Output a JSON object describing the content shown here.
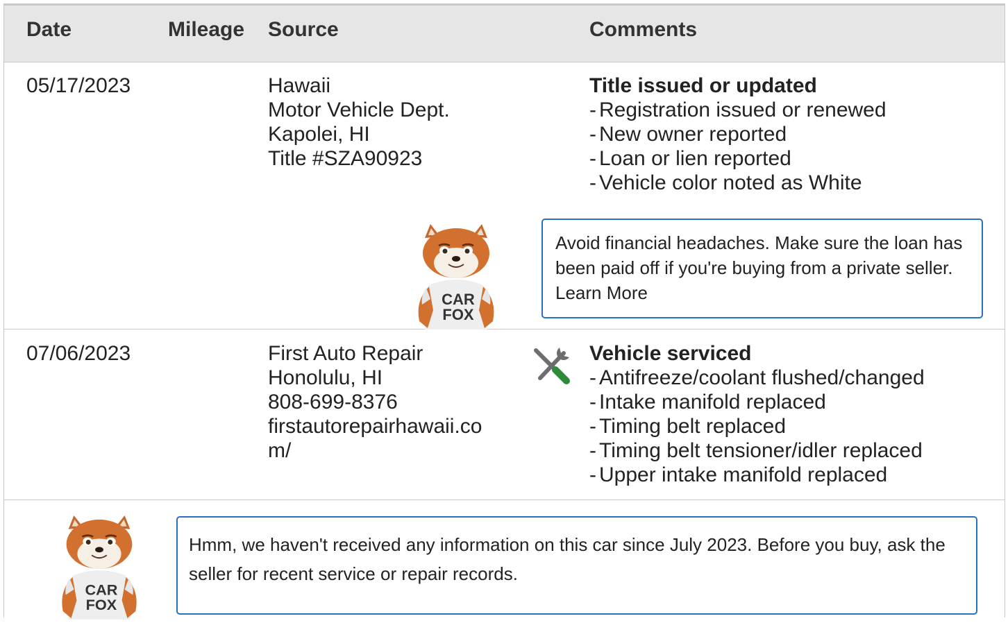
{
  "header": {
    "date": "Date",
    "mileage": "Mileage",
    "source": "Source",
    "comments": "Comments"
  },
  "records": [
    {
      "date": "05/17/2023",
      "source_lines": [
        "Hawaii",
        "Motor Vehicle Dept.",
        "Kapolei, HI",
        "Title #SZA90923"
      ],
      "comment_title": "Title issued or updated",
      "comment_items": [
        "Registration issued or renewed",
        "New owner reported",
        "Loan or lien reported",
        "Vehicle color noted as White"
      ],
      "callout_text": "Avoid financial headaches. Make sure the loan has been paid off if you're buying from a private seller.",
      "callout_link": "Learn More"
    },
    {
      "date": "07/06/2023",
      "source_lines": [
        "First Auto Repair",
        "Honolulu, HI",
        "808-699-8376",
        "firstautorepairhawaii.co",
        "m/"
      ],
      "comment_icon": "wrench-screwdriver-icon",
      "comment_title": "Vehicle serviced",
      "comment_items": [
        "Antifreeze/coolant flushed/changed",
        "Intake manifold replaced",
        "Timing belt replaced",
        "Timing belt tensioner/idler replaced",
        "Upper intake manifold replaced"
      ]
    }
  ],
  "notice": {
    "text": "Hmm, we haven't received any information on this car since July 2023. Before you buy, ask the seller for recent service or repair records."
  },
  "mascot": {
    "shirt_line1": "CAR",
    "shirt_line2": "FOX"
  },
  "colors": {
    "callout_border": "#2b6fc1",
    "header_bg": "#e6e6e6",
    "icon_green": "#2e8b3a",
    "icon_gray": "#6d6d6d"
  },
  "dash": "-"
}
